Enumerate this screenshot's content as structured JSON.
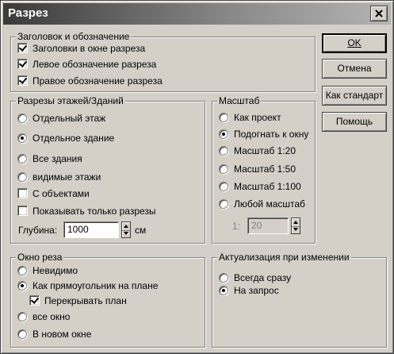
{
  "window": {
    "title": "Разрез"
  },
  "buttons": {
    "ok": "OK",
    "cancel": "Отмена",
    "as_default": "Как стандарт",
    "help": "Помощь"
  },
  "heading_group": {
    "title": "Заголовок и обозначение",
    "items": [
      {
        "label": "Заголовки в окне разреза",
        "checked": true
      },
      {
        "label": "Левое обозначение разреза",
        "checked": true
      },
      {
        "label": "Правое обозначение разреза",
        "checked": true
      }
    ]
  },
  "floors_group": {
    "title": "Разрезы этажей/Зданий",
    "radios": [
      {
        "label": "Отдельный этаж",
        "selected": false
      },
      {
        "label": "Отдельное здание",
        "selected": true
      },
      {
        "label": "Все здания",
        "selected": false
      },
      {
        "label": "видимые этажи",
        "selected": false
      }
    ],
    "checkboxes": [
      {
        "label": "С объектами",
        "checked": false
      },
      {
        "label": "Показывать только разрезы",
        "checked": false
      }
    ],
    "depth_label": "Глубина:",
    "depth_value": "1000",
    "depth_unit": "см"
  },
  "scale_group": {
    "title": "Масштаб",
    "radios": [
      {
        "label": "Как проект",
        "selected": false
      },
      {
        "label": "Подогнать к окну",
        "selected": true
      },
      {
        "label": "Масштаб 1:20",
        "selected": false
      },
      {
        "label": "Масштаб 1:50",
        "selected": false
      },
      {
        "label": "Масштаб 1:100",
        "selected": false
      },
      {
        "label": "Любой масштаб",
        "selected": false
      }
    ],
    "custom_label": "1:",
    "custom_value": "20"
  },
  "cut_window_group": {
    "title": "Окно реза",
    "radios": [
      {
        "label": "Невидимо",
        "selected": false
      },
      {
        "label": "Как прямоугольник на плане",
        "selected": true
      },
      {
        "label": "все окно",
        "selected": false
      },
      {
        "label": "В новом окне",
        "selected": false
      }
    ],
    "overlap_checkbox": {
      "label": "Перекрывать план",
      "checked": true
    }
  },
  "update_group": {
    "title": "Актуализация при изменении",
    "radios": [
      {
        "label": "Всегда сразу",
        "selected": false
      },
      {
        "label": "На запрос",
        "selected": true
      }
    ]
  }
}
